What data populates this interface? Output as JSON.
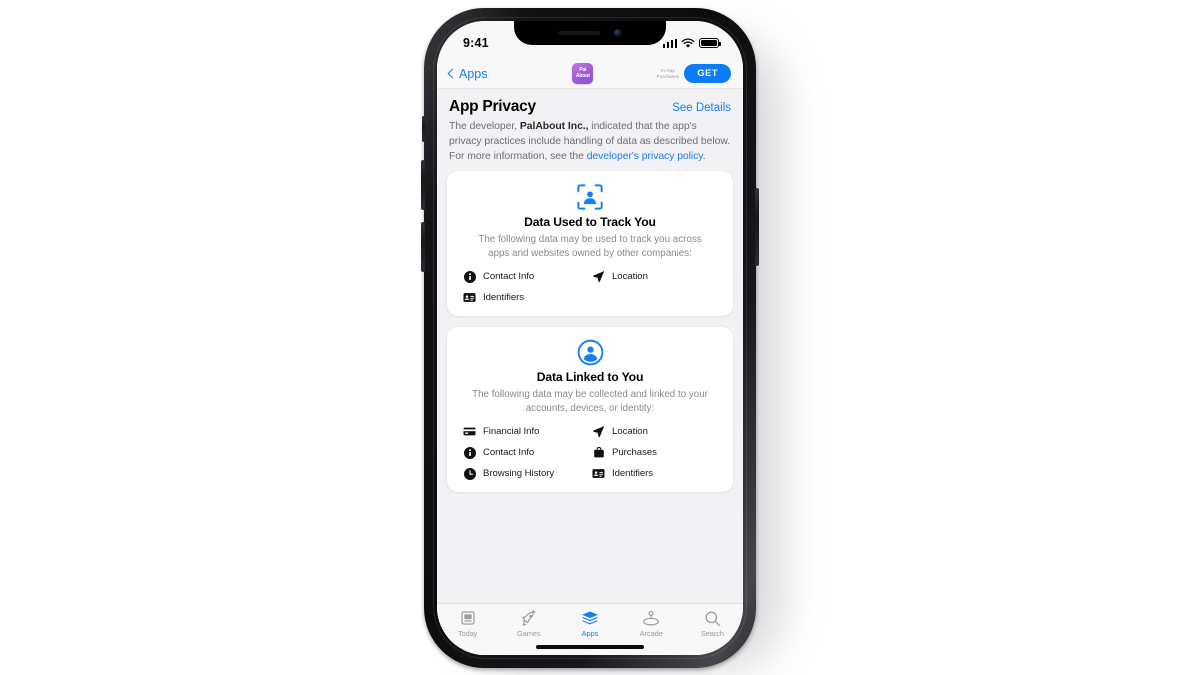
{
  "status_bar": {
    "time": "9:41",
    "signal_icon": "cellular-bars-icon",
    "wifi_icon": "wifi-icon",
    "battery_icon": "battery-full-icon"
  },
  "nav_bar": {
    "back_label": "Apps",
    "back_icon": "chevron-left-icon",
    "app_icon_line1": "Pal",
    "app_icon_line2": "About",
    "in_app_purchases_line1": "In-App",
    "in_app_purchases_line2": "Purchases",
    "get_label": "GET"
  },
  "section": {
    "title": "App Privacy",
    "see_details_label": "See Details",
    "blurb_part1": "The developer, ",
    "blurb_developer": "PalAbout Inc.,",
    "blurb_part2": " indicated that the app's privacy practices include handling of data as described below. For more information, see the ",
    "blurb_link": "developer's privacy policy",
    "blurb_part3": "."
  },
  "cards": [
    {
      "icon": "person-in-viewfinder-icon",
      "title": "Data Used to Track You",
      "subtitle": "The following data may be used to track you across apps and websites owned by other companies:",
      "items": [
        {
          "label": "Contact Info",
          "icon": "info-circle-icon"
        },
        {
          "label": "Location",
          "icon": "location-arrow-icon"
        },
        {
          "label": "Identifiers",
          "icon": "id-card-icon"
        }
      ]
    },
    {
      "icon": "person-circle-icon",
      "title": "Data Linked to You",
      "subtitle": "The following data may be collected and linked to your accounts, devices, or identity:",
      "items": [
        {
          "label": "Financial Info",
          "icon": "credit-card-icon"
        },
        {
          "label": "Location",
          "icon": "location-arrow-icon"
        },
        {
          "label": "Contact Info",
          "icon": "info-circle-icon"
        },
        {
          "label": "Purchases",
          "icon": "shopping-bag-icon"
        },
        {
          "label": "Browsing History",
          "icon": "clock-icon"
        },
        {
          "label": "Identifiers",
          "icon": "id-card-icon"
        }
      ]
    }
  ],
  "tab_bar": {
    "tabs": [
      {
        "label": "Today",
        "icon": "today-newspaper-icon",
        "active": false
      },
      {
        "label": "Games",
        "icon": "rocket-icon",
        "active": false
      },
      {
        "label": "Apps",
        "icon": "stacked-layers-icon",
        "active": true
      },
      {
        "label": "Arcade",
        "icon": "arcade-joystick-icon",
        "active": false
      },
      {
        "label": "Search",
        "icon": "magnifying-glass-icon",
        "active": false
      }
    ]
  },
  "colors": {
    "accent_blue": "#147efb",
    "get_button_blue": "#0a7cf5",
    "screen_background": "#f2f2f4",
    "card_background": "#ffffff",
    "secondary_text": "#8a8a8f"
  }
}
